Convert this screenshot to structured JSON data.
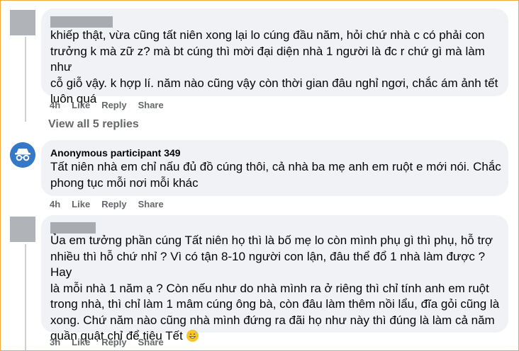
{
  "comments": [
    {
      "author": "",
      "text": "khiếp thật, vừa cũng tất niên xong lại lo cúng đầu năm, hỏi chứ nhà c có phải con\ntrưởng k mà zữ z? mà bt cúng thì mời đại diện nhà 1 người là đc r chứ gì mà làm như\ncỗ giỗ vậy. k hợp lí. năm nào cũng vậy còn thời gian đâu nghỉ ngơi, chắc ám ảnh tết\nluôn quá",
      "time": "4h",
      "like": "Like",
      "reply": "Reply",
      "share": "Share",
      "view_replies": "View all 5 replies"
    },
    {
      "author": "Anonymous participant 349",
      "text": "Tất niên nhà em chỉ nấu đủ đồ cúng thôi, cả nhà ba mẹ anh em ruột e mới nói. Chắc\nphong tục mỗi nơi mỗi khác",
      "time": "4h",
      "like": "Like",
      "reply": "Reply",
      "share": "Share",
      "avatar_icon": "anonymous-incognito-icon"
    },
    {
      "author": "",
      "text": "Ủa em tưởng phần cúng Tất niên họ thì là bố mẹ lo còn mình phụ gì thì phụ, hỗ trợ\nnhiều thì hỗ chứ nhỉ ? Vì có tận 8-10 người con lận, đâu thể đổ 1 nhà làm được ? Hay\nlà mỗi nhà 1 năm ạ ? Còn nếu như do nhà mình ra ở riêng thì chỉ tính anh em ruột\ntrong nhà, thì chỉ làm 1 mâm cúng ông bà, còn đâu làm thêm nồi lẩu, đĩa gỏi cũng là\nxong. Chứ năm nào cũng nhà mình đứng ra đãi họ như này thì đúng là làm cả năm\nquần quật chỉ để tiêu Tết",
      "emoji": "grinning-sweat-emoji",
      "time": "3h",
      "like": "Like",
      "reply": "Reply",
      "share": "Share"
    }
  ],
  "colors": {
    "frame_border": "#f2a93b",
    "bubble": "#f0f2f5",
    "secondary_text": "#65676b",
    "anon_avatar": "#3578c7"
  }
}
